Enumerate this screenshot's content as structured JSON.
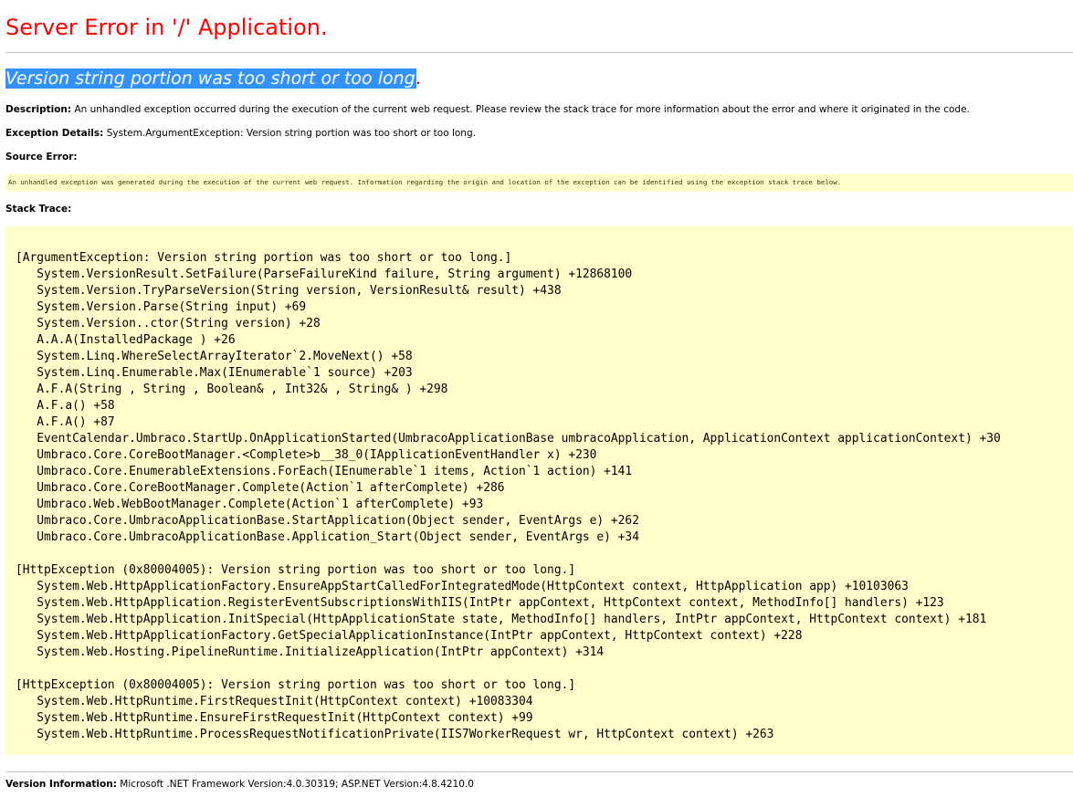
{
  "page": {
    "title": "Server Error in '/' Application.",
    "error_message": "Version string portion was too short or too long",
    "error_message_suffix": ".",
    "description_label": "Description:",
    "description_text": " An unhandled exception occurred during the execution of the current web request. Please review the stack trace for more information about the error and where it originated in the code.",
    "exception_label": "Exception Details:",
    "exception_text": " System.ArgumentException: Version string portion was too short or too long.",
    "source_error_label": "Source Error:",
    "source_error_text": "An unhandled exception was generated during the execution of the current web request. Information regarding the origin and location of the exception can be identified using the exception stack trace below.",
    "stack_trace_label": "Stack Trace:",
    "stack_trace": "[ArgumentException: Version string portion was too short or too long.]\n   System.VersionResult.SetFailure(ParseFailureKind failure, String argument) +12868100\n   System.Version.TryParseVersion(String version, VersionResult& result) +438\n   System.Version.Parse(String input) +69\n   System.Version..ctor(String version) +28\n   A.A.A(InstalledPackage ) +26\n   System.Linq.WhereSelectArrayIterator`2.MoveNext() +58\n   System.Linq.Enumerable.Max(IEnumerable`1 source) +203\n   A.F.A(String , String , Boolean& , Int32& , String& ) +298\n   A.F.a() +58\n   A.F.A() +87\n   EventCalendar.Umbraco.StartUp.OnApplicationStarted(UmbracoApplicationBase umbracoApplication, ApplicationContext applicationContext) +30\n   Umbraco.Core.CoreBootManager.<Complete>b__38_0(IApplicationEventHandler x) +230\n   Umbraco.Core.EnumerableExtensions.ForEach(IEnumerable`1 items, Action`1 action) +141\n   Umbraco.Core.CoreBootManager.Complete(Action`1 afterComplete) +286\n   Umbraco.Web.WebBootManager.Complete(Action`1 afterComplete) +93\n   Umbraco.Core.UmbracoApplicationBase.StartApplication(Object sender, EventArgs e) +262\n   Umbraco.Core.UmbracoApplicationBase.Application_Start(Object sender, EventArgs e) +34\n\n[HttpException (0x80004005): Version string portion was too short or too long.]\n   System.Web.HttpApplicationFactory.EnsureAppStartCalledForIntegratedMode(HttpContext context, HttpApplication app) +10103063\n   System.Web.HttpApplication.RegisterEventSubscriptionsWithIIS(IntPtr appContext, HttpContext context, MethodInfo[] handlers) +123\n   System.Web.HttpApplication.InitSpecial(HttpApplicationState state, MethodInfo[] handlers, IntPtr appContext, HttpContext context) +181\n   System.Web.HttpApplicationFactory.GetSpecialApplicationInstance(IntPtr appContext, HttpContext context) +228\n   System.Web.Hosting.PipelineRuntime.InitializeApplication(IntPtr appContext) +314\n\n[HttpException (0x80004005): Version string portion was too short or too long.]\n   System.Web.HttpRuntime.FirstRequestInit(HttpContext context) +10083304\n   System.Web.HttpRuntime.EnsureFirstRequestInit(HttpContext context) +99\n   System.Web.HttpRuntime.ProcessRequestNotificationPrivate(IIS7WorkerRequest wr, HttpContext context) +263",
    "version_label": "Version Information:",
    "version_text": " Microsoft .NET Framework Version:4.0.30319; ASP.NET Version:4.8.4210.0"
  },
  "colors": {
    "title": "#ff0000",
    "error_message": "#800000",
    "selection_highlight": "#3391ff",
    "code_background": "#ffffcc",
    "rule": "#c0c0c0"
  }
}
